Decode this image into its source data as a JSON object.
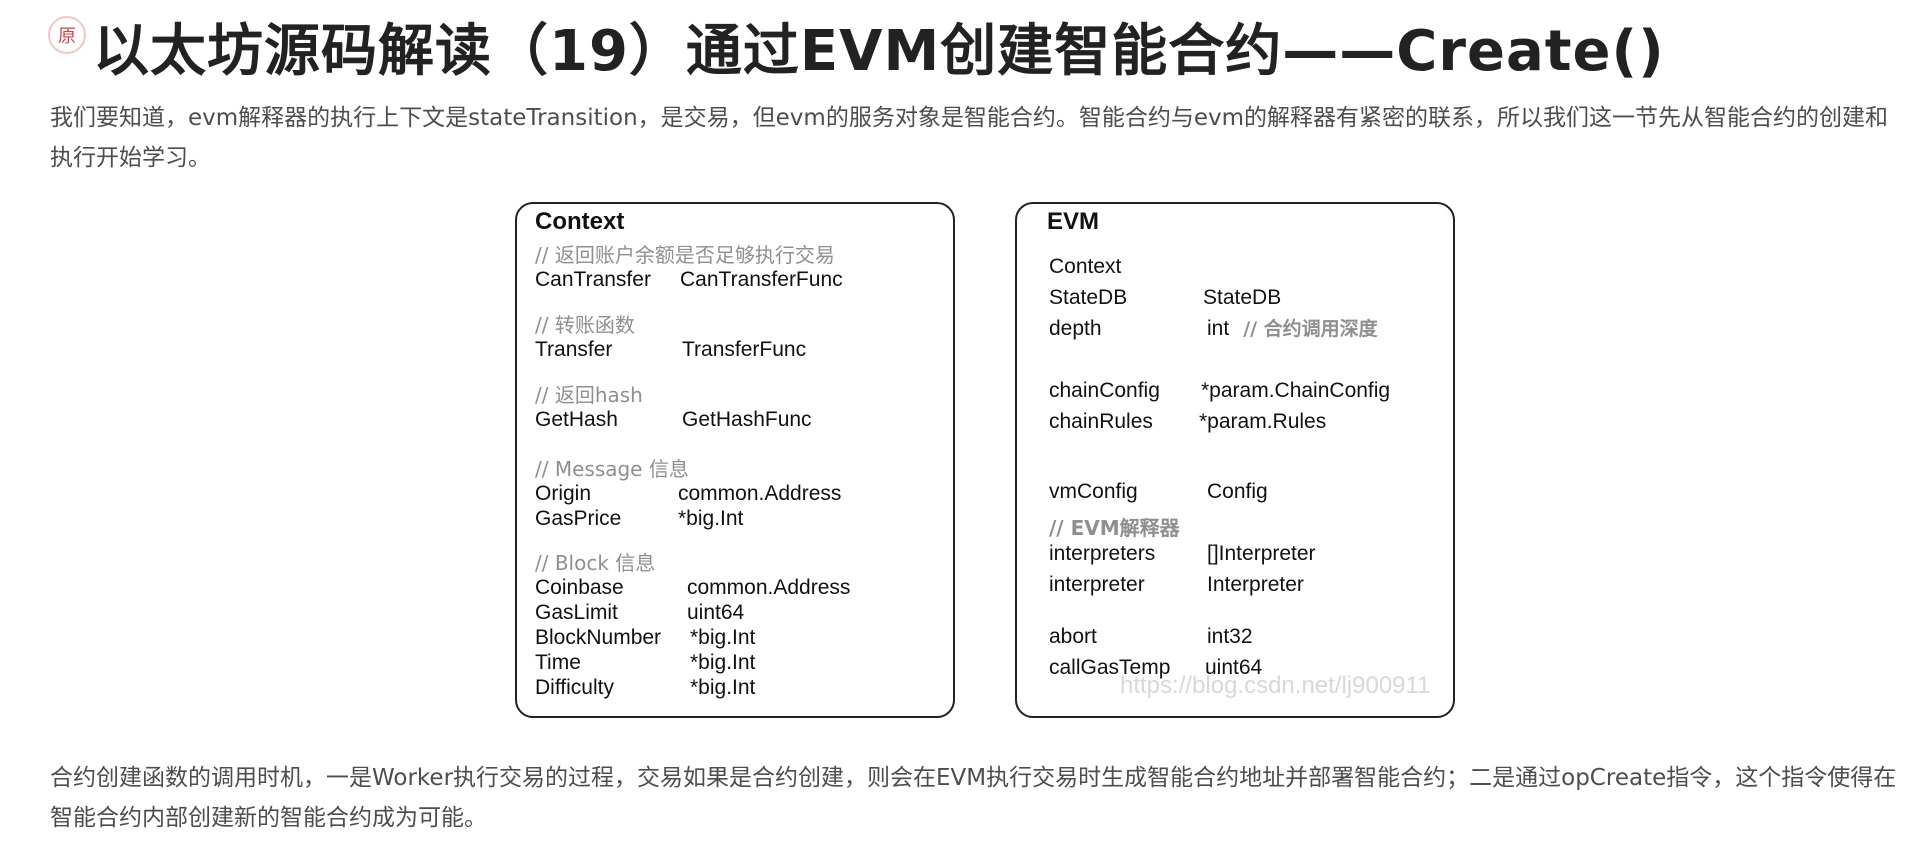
{
  "article": {
    "badge": "原",
    "title": "以太坊源码解读（19）通过EVM创建智能合约——Create()",
    "intro": "我们要知道，evm解释器的执行上下文是stateTransition，是交易，但evm的服务对象是智能合约。智能合约与evm的解释器有紧密的联系，所以我们这一节先从智能合约的创建和执行开始学习。",
    "bottom": "合约创建函数的调用时机，一是Worker执行交易的过程，交易如果是合约创建，则会在EVM执行交易时生成智能合约地址并部署智能合约；二是通过opCreate指令，这个指令使得在智能合约内部创建新的智能合约成为可能。"
  },
  "figure": {
    "context": {
      "title": "Context",
      "groups": [
        {
          "comment": "// 返回账户余额是否足够执行交易",
          "fields": [
            {
              "name": "CanTransfer",
              "type": "CanTransferFunc"
            }
          ]
        },
        {
          "comment": "// 转账函数",
          "fields": [
            {
              "name": "Transfer",
              "type": "TransferFunc"
            }
          ]
        },
        {
          "comment": "// 返回hash",
          "fields": [
            {
              "name": "GetHash",
              "type": "GetHashFunc"
            }
          ]
        },
        {
          "comment": "// Message 信息",
          "fields": [
            {
              "name": "Origin",
              "type": "common.Address"
            },
            {
              "name": "GasPrice",
              "type": "*big.Int"
            }
          ]
        },
        {
          "comment": "// Block 信息",
          "fields": [
            {
              "name": "Coinbase",
              "type": "common.Address"
            },
            {
              "name": "GasLimit",
              "type": "uint64"
            },
            {
              "name": "BlockNumber",
              "type": "*big.Int"
            },
            {
              "name": "Time",
              "type": "*big.Int"
            },
            {
              "name": "Difficulty",
              "type": "*big.Int"
            }
          ]
        }
      ]
    },
    "evm": {
      "title": "EVM",
      "fields": {
        "context": {
          "name": "Context"
        },
        "statedb": {
          "name": "StateDB",
          "type": "StateDB"
        },
        "depth": {
          "name": "depth",
          "type": "int",
          "comment": "// 合约调用深度"
        },
        "chainconfig": {
          "name": "chainConfig",
          "type": "*param.ChainConfig"
        },
        "chainrules": {
          "name": "chainRules",
          "type": "*param.Rules"
        },
        "vmconfig": {
          "name": "vmConfig",
          "type": "Config"
        },
        "interp_comment": "//  EVM解释器",
        "interpreters": {
          "name": "interpreters",
          "type": "[]Interpreter"
        },
        "interpreter": {
          "name": "interpreter",
          "type": "Interpreter"
        },
        "abort": {
          "name": "abort",
          "type": "int32"
        },
        "callgastemp": {
          "name": "callGasTemp",
          "type": "uint64"
        }
      }
    },
    "watermark": "https://blog.csdn.net/lj900911"
  }
}
